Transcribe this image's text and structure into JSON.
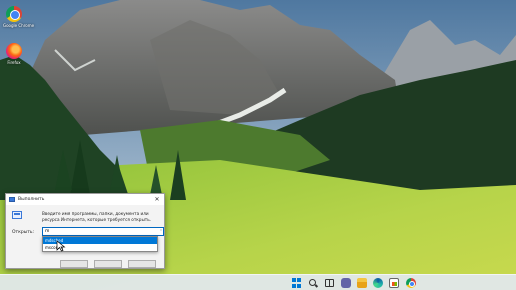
{
  "desktop": {
    "icons": [
      {
        "label": "Google Chrome",
        "icon": "chrome-icon"
      },
      {
        "label": "Firefox",
        "icon": "firefox-icon"
      }
    ]
  },
  "run_dialog": {
    "title": "Выполнить",
    "description": "Введите имя программы, папки, документа или ресурса Интернета, которые требуется открыть.",
    "open_label": "Открыть:",
    "input_value": "m",
    "dropdown_arrow": "˅",
    "suggestions": [
      "mdsched",
      "msconfig"
    ],
    "selected_suggestion_index": 0,
    "close_glyph": "✕"
  },
  "taskbar": {
    "icons": [
      "start-icon",
      "search-icon",
      "task-view-icon",
      "chat-icon",
      "file-explorer-icon",
      "edge-icon",
      "store-icon",
      "chrome-icon"
    ]
  }
}
